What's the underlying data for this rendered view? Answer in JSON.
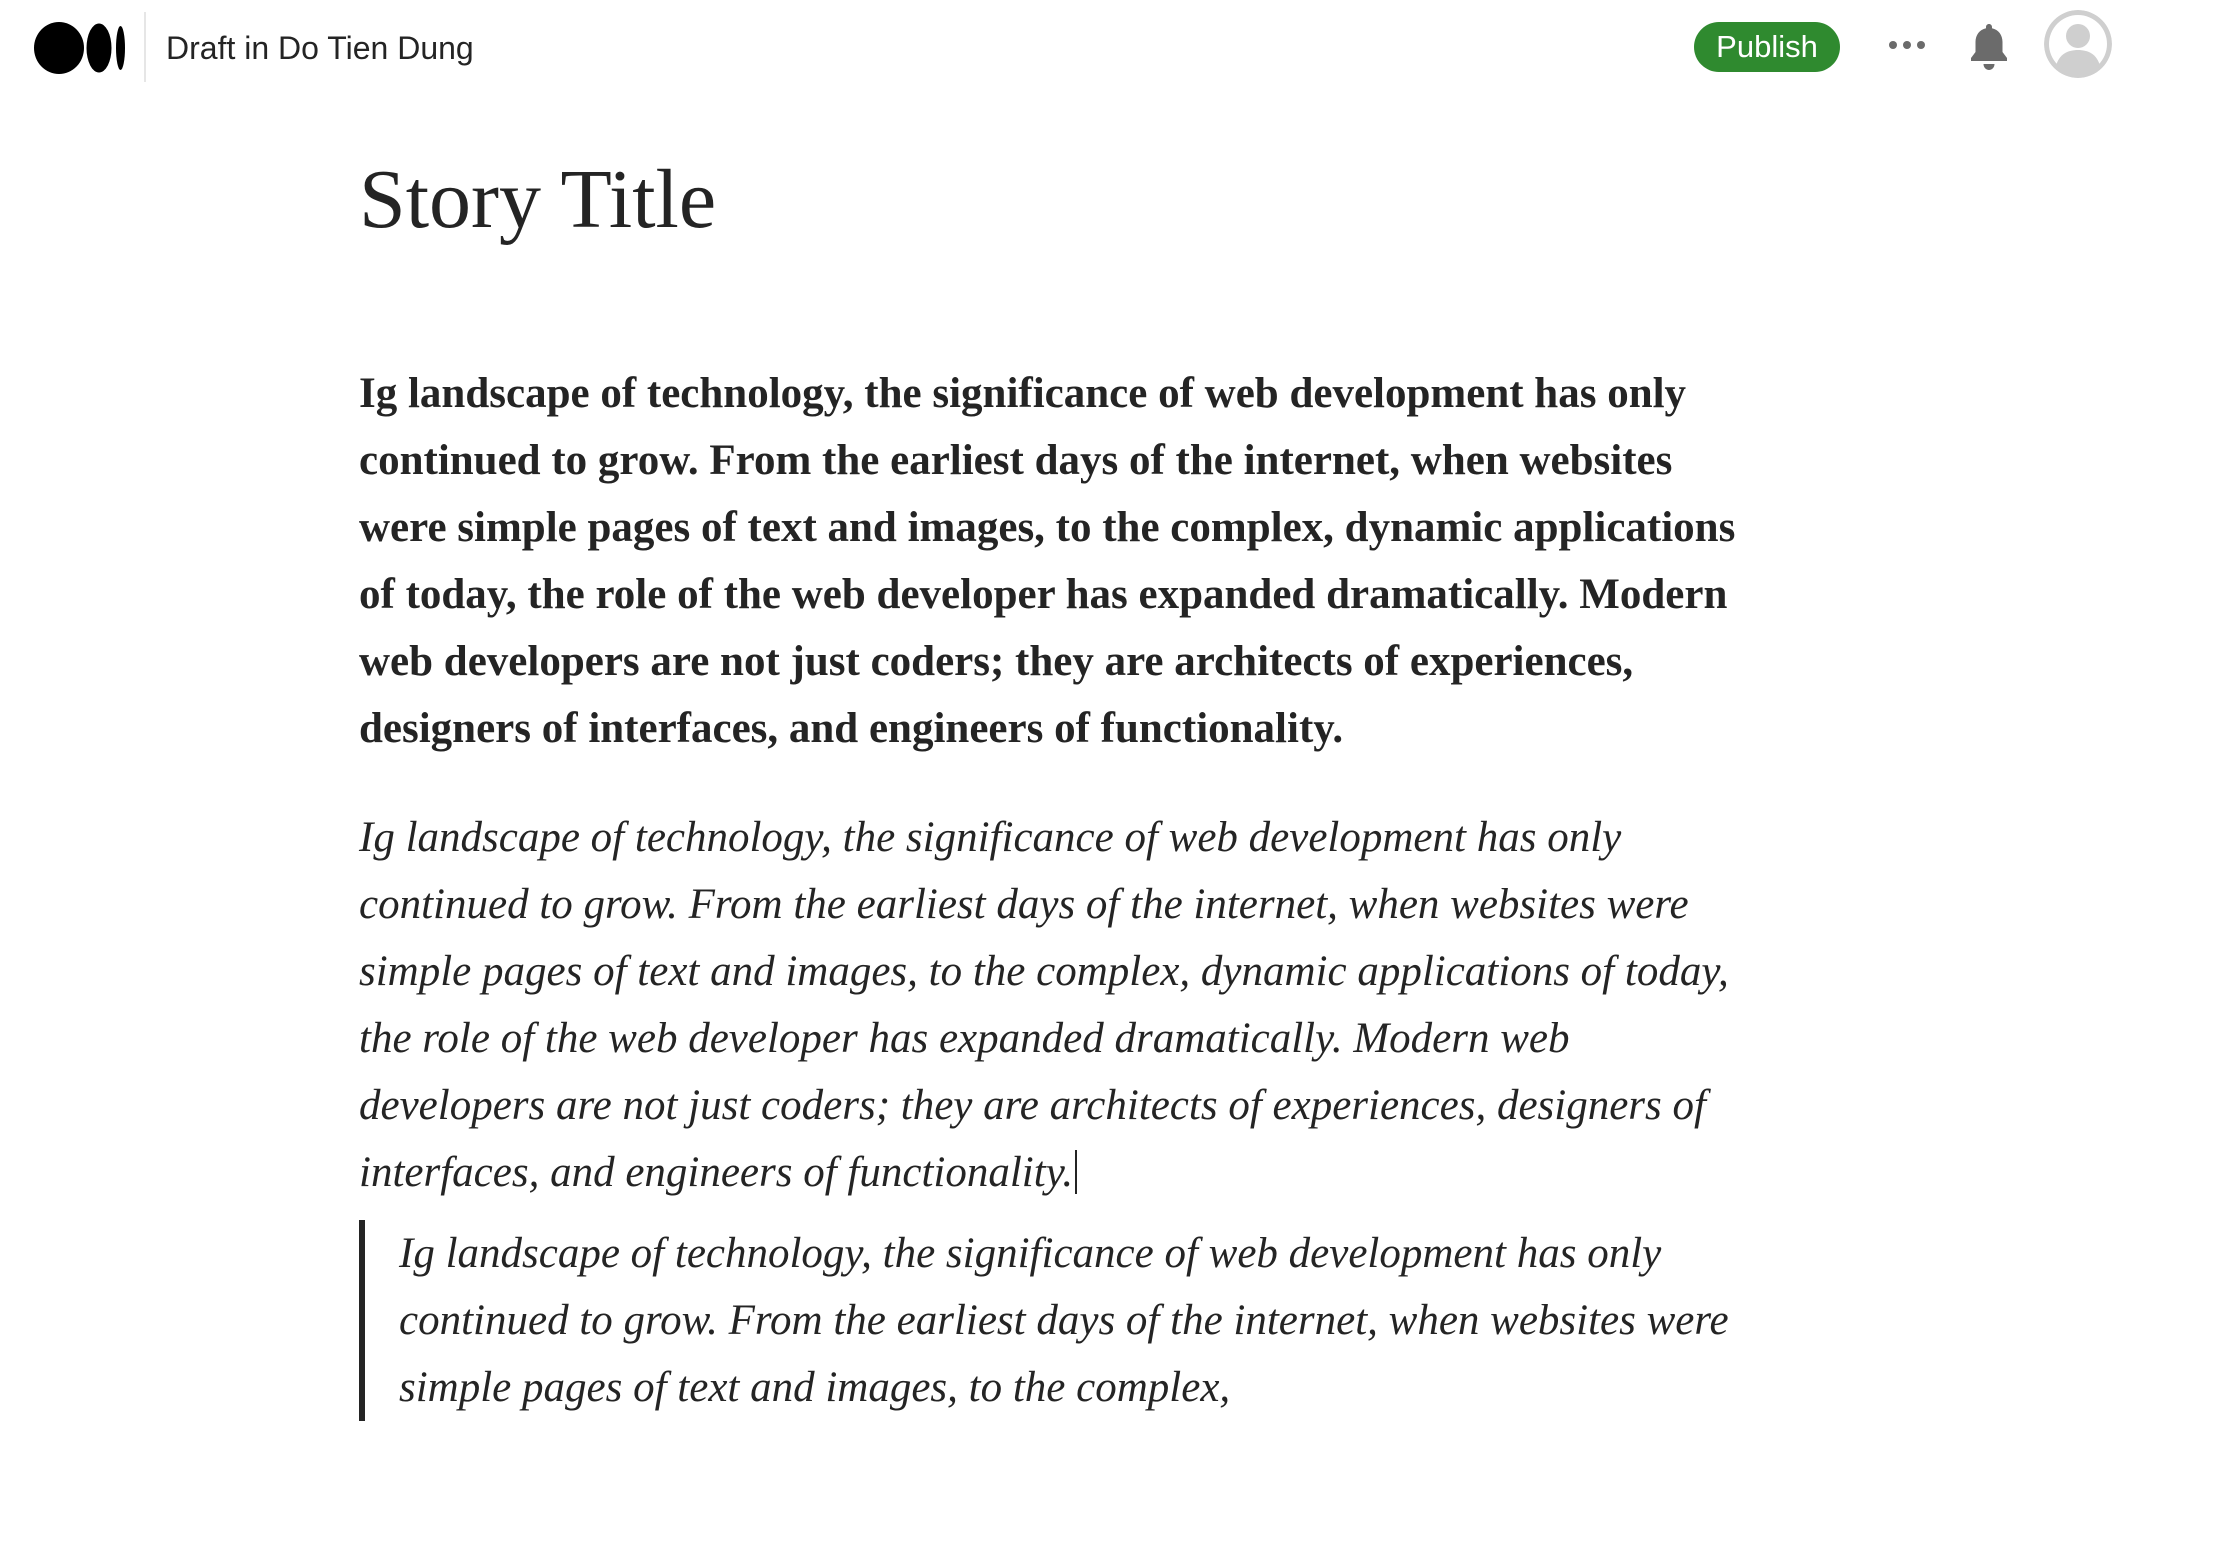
{
  "header": {
    "logo_icon": "medium-logo-icon",
    "draft_label": "Draft in Do Tien Dung",
    "publish_label": "Publish",
    "more_icon": "more-horizontal-icon",
    "notifications_icon": "bell-icon",
    "avatar_icon": "user-avatar-icon",
    "accent_color": "#2f8a2f"
  },
  "story": {
    "title": "Story Title",
    "paragraphs": [
      {
        "style": "bold",
        "text": "Ig landscape of technology, the significance of web development has only continued to grow. From the earliest days of the internet, when websites were simple pages of text and images, to the complex, dynamic applications of today, the role of the web developer has expanded dramatically. Modern web developers are not just coders; they are architects of experiences, designers of interfaces, and engineers of functionality."
      },
      {
        "style": "italic",
        "text": "Ig landscape of technology, the significance of web development has only continued to grow. From the earliest days of the internet, when websites were simple pages of text and images, to the complex, dynamic applications of today, the role of the web developer has expanded dramatically. Modern web developers are not just coders; they are architects of experiences, designers of interfaces, and engineers of functionality."
      },
      {
        "style": "blockquote",
        "text": "Ig landscape of technology, the significance of web development has only continued to grow. From the earliest days of the internet, when websites were simple pages of text and images, to the complex,"
      }
    ]
  }
}
